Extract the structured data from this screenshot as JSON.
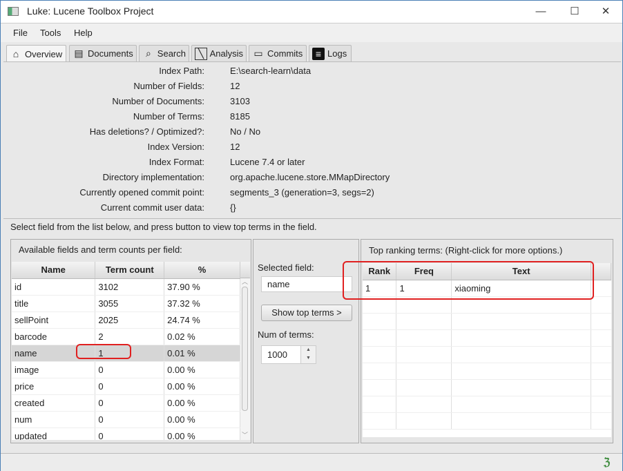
{
  "window": {
    "title": "Luke: Lucene Toolbox Project",
    "controls": [
      "—",
      "☐",
      "✕"
    ]
  },
  "menu": [
    "File",
    "Tools",
    "Help"
  ],
  "tabs": [
    {
      "label": "Overview",
      "icon": "home-icon"
    },
    {
      "label": "Documents",
      "icon": "document-icon"
    },
    {
      "label": "Search",
      "icon": "search-icon"
    },
    {
      "label": "Analysis",
      "icon": "pen-icon"
    },
    {
      "label": "Commits",
      "icon": "drive-icon"
    },
    {
      "label": "Logs",
      "icon": "log-icon"
    }
  ],
  "overview": {
    "rows": [
      {
        "label": "Index Path:",
        "value": "E:\\search-learn\\data"
      },
      {
        "label": "Number of Fields:",
        "value": "12"
      },
      {
        "label": "Number of Documents:",
        "value": "3103"
      },
      {
        "label": "Number of Terms:",
        "value": "8185"
      },
      {
        "label": "Has deletions? / Optimized?:",
        "value": "No / No"
      },
      {
        "label": "Index Version:",
        "value": "12"
      },
      {
        "label": "Index Format:",
        "value": "Lucene 7.4 or later"
      },
      {
        "label": "Directory implementation:",
        "value": "org.apache.lucene.store.MMapDirectory"
      },
      {
        "label": "Currently opened commit point:",
        "value": "segments_3 (generation=3, segs=2)"
      },
      {
        "label": "Current commit user data:",
        "value": "{}"
      }
    ],
    "instruction": "Select field from the list below, and press button to view top terms in the field."
  },
  "fields": {
    "title": "Available fields and term counts per field:",
    "columns": [
      "Name",
      "Term count",
      "%"
    ],
    "rows": [
      [
        "id",
        "3102",
        "37.90 %"
      ],
      [
        "title",
        "3055",
        "37.32 %"
      ],
      [
        "sellPoint",
        "2025",
        "24.74 %"
      ],
      [
        "barcode",
        "2",
        "0.02 %"
      ],
      [
        "name",
        "1",
        "0.01 %"
      ],
      [
        "image",
        "0",
        "0.00 %"
      ],
      [
        "price",
        "0",
        "0.00 %"
      ],
      [
        "created",
        "0",
        "0.00 %"
      ],
      [
        "num",
        "0",
        "0.00 %"
      ],
      [
        "updated",
        "0",
        "0.00 %"
      ]
    ],
    "selected_row": "name"
  },
  "controls": {
    "selected_field_label": "Selected field:",
    "selected_field_value": "name",
    "show_button": "Show top terms >",
    "num_terms_label": "Num of terms:",
    "num_terms_value": "1000"
  },
  "top_terms": {
    "title": "Top ranking terms: (Right-click for more options.)",
    "columns": [
      "Rank",
      "Freq",
      "Text"
    ],
    "rows": [
      [
        "1",
        "1",
        "xiaoming"
      ]
    ]
  },
  "colors": {
    "annotation": "#e02020",
    "window_border": "#4a7fb5"
  }
}
